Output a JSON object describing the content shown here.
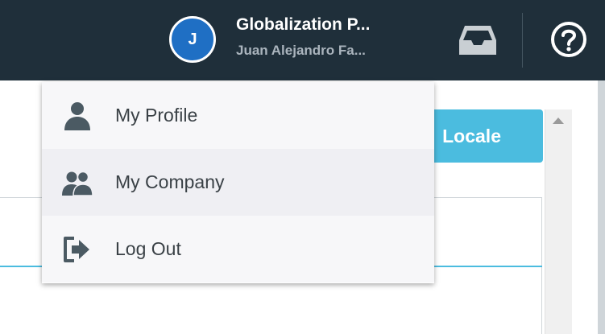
{
  "header": {
    "avatar_initial": "J",
    "org_name": "Globalization P...",
    "user_name": "Juan Alejandro Fa...",
    "icons": [
      "inbox-icon",
      "help-icon"
    ]
  },
  "background": {
    "locale_button_label": "Locale"
  },
  "menu": {
    "items": [
      {
        "label": "My Profile",
        "icon": "person-icon"
      },
      {
        "label": "My Company",
        "icon": "people-icon"
      },
      {
        "label": "Log Out",
        "icon": "logout-icon"
      }
    ]
  },
  "colors": {
    "header_bg": "#1f2f3a",
    "avatar_bg": "#1f6fc4",
    "accent": "#4bbcdf",
    "menu_text": "#3a4146",
    "icon": "#4b5a63"
  }
}
